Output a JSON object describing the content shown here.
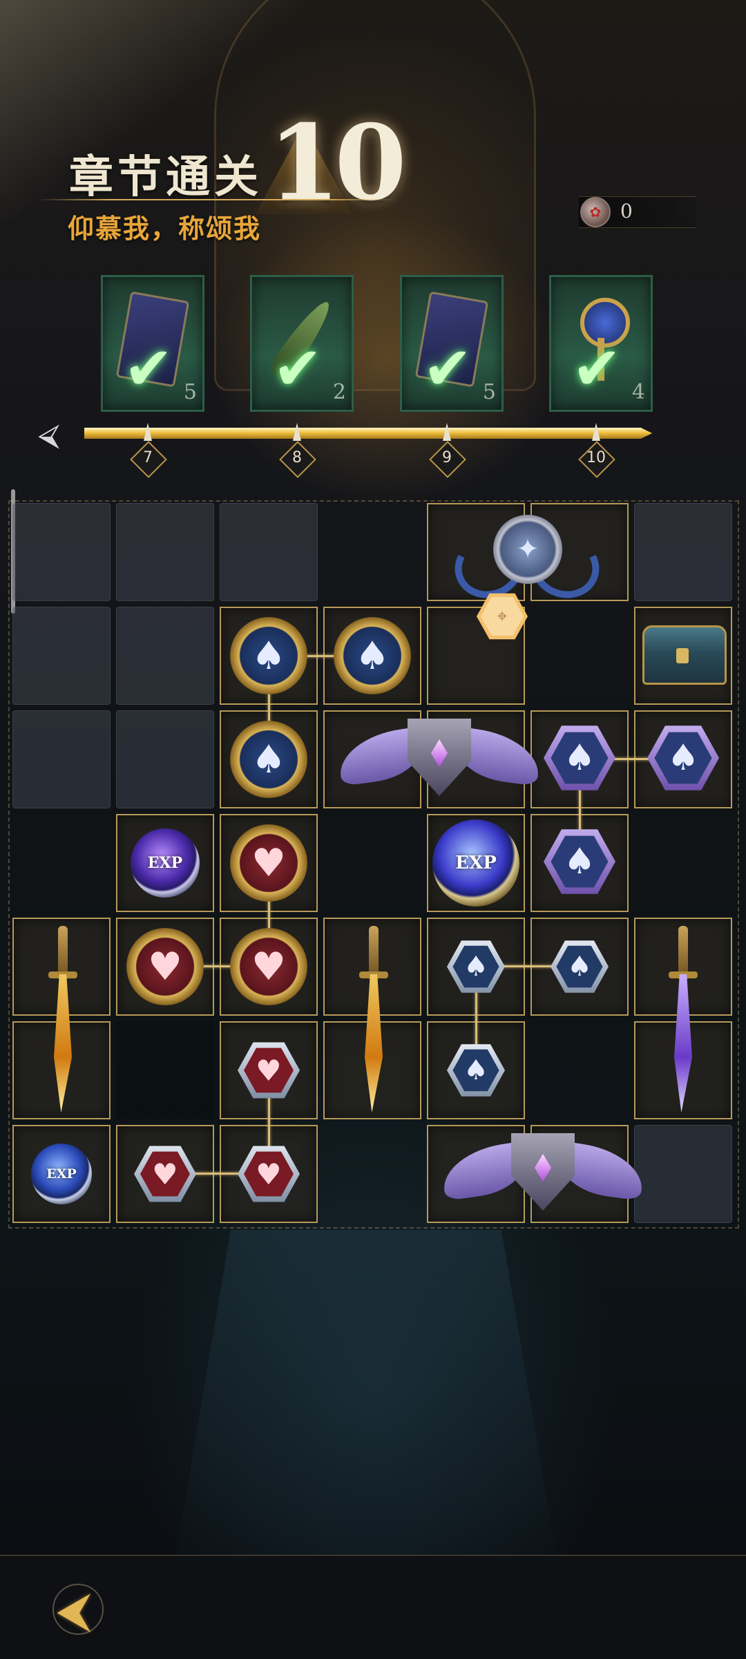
{
  "header": {
    "title": "章节通关",
    "chapter_number": "10",
    "subtitle": "仰慕我，称颂我"
  },
  "currency": {
    "icon": "circular-token-icon",
    "value": "0"
  },
  "rewards": [
    {
      "item": "card-pack-icon",
      "quantity": "5",
      "claimed": true
    },
    {
      "item": "feather-icon",
      "quantity": "2",
      "claimed": true
    },
    {
      "item": "card-pack-icon",
      "quantity": "5",
      "claimed": true
    },
    {
      "item": "key-icon",
      "quantity": "4",
      "claimed": true
    }
  ],
  "progress": {
    "milestones": [
      "7",
      "8",
      "9",
      "10"
    ],
    "fill_fraction": 1.0
  },
  "board": {
    "tokens": {
      "exp_label": "EXP"
    }
  },
  "colors": {
    "gold_accent": "#d9bd78",
    "subtitle_orange": "#e8a63a",
    "claimed_green": "#2a5a46"
  }
}
